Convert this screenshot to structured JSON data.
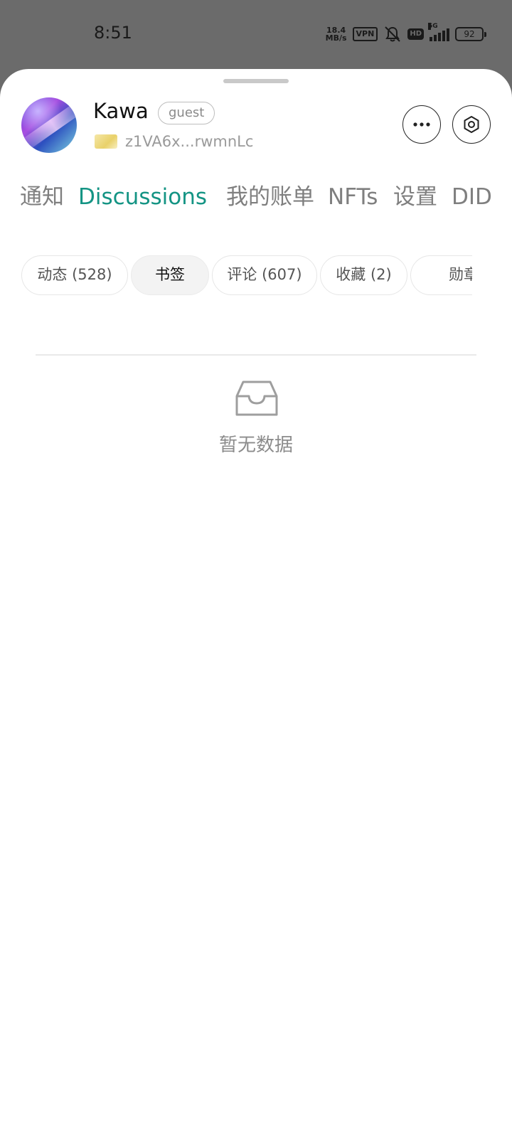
{
  "status_bar": {
    "time": "8:51",
    "net_speed_value": "18.4",
    "net_speed_unit": "MB/s",
    "vpn": "VPN",
    "hd": "HD",
    "network": "5G",
    "battery": "92"
  },
  "profile": {
    "name": "Kawa",
    "role": "guest",
    "address": "z1VA6x...rwmnLc"
  },
  "tabs": [
    {
      "label": "通知"
    },
    {
      "label": "Discussions"
    },
    {
      "label": "我的账单"
    },
    {
      "label": "NFTs"
    },
    {
      "label": "设置"
    },
    {
      "label": "DID"
    }
  ],
  "active_tab": "Discussions",
  "filters": [
    {
      "label": "动态 (528)"
    },
    {
      "label": "书签"
    },
    {
      "label": "评论 (607)"
    },
    {
      "label": "收藏 (2)"
    },
    {
      "label": "勋章"
    }
  ],
  "selected_filter": "书签",
  "empty_state": {
    "text": "暂无数据",
    "icon": "inbox-icon"
  },
  "colors": {
    "accent": "#149484",
    "overlay": "#6b6b6b"
  }
}
